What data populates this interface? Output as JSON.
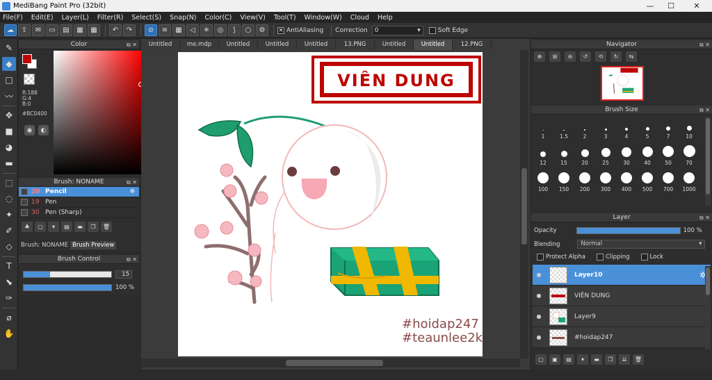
{
  "window": {
    "title": "MediBang Paint Pro (32bit)",
    "minimize": "—",
    "maximize": "☐",
    "close": "✕"
  },
  "menu": [
    "File(F)",
    "Edit(E)",
    "Layer(L)",
    "Filter(R)",
    "Select(S)",
    "Snap(N)",
    "Color(C)",
    "View(V)",
    "Tool(T)",
    "Window(W)",
    "Cloud",
    "Help"
  ],
  "toolbar": {
    "antialiasing_label": "AntiAliasing",
    "correction_label": "Correction",
    "correction_value": "0",
    "soft_edge_label": "Soft Edge"
  },
  "color_panel": {
    "title": "Color",
    "r": "R:188",
    "g": "G:4",
    "b": "B:0",
    "hex": "#BC0400",
    "fg_color": "#BC0400"
  },
  "brush_panel": {
    "title": "Brush: NONAME",
    "items": [
      {
        "size": "20",
        "name": "Pencil",
        "selected": true
      },
      {
        "size": "19",
        "name": "Pen",
        "selected": false
      },
      {
        "size": "30",
        "name": "Pen (Sharp)",
        "selected": false
      }
    ],
    "tab_brush": "Brush: NONAME",
    "tab_preview": "Brush Preview"
  },
  "brush_control": {
    "title": "Brush Control",
    "size_value": "15",
    "opacity_value": "100 %",
    "size_fraction": 0.3,
    "opacity_fraction": 1.0
  },
  "document_tabs": [
    "Untitled",
    "me.mdp",
    "Untitled",
    "Untitled",
    "Untitled",
    "13.PNG",
    "Untitled",
    "Untitled",
    "12.PNG"
  ],
  "active_tab_index": 7,
  "canvas": {
    "stamp_text": "VIÊN DUNG",
    "tag1": "#hoidap247",
    "tag2": "#teaunlee2k"
  },
  "navigator": {
    "title": "Navigator"
  },
  "brush_size": {
    "title": "Brush Size",
    "sizes": [
      "1",
      "1.5",
      "2",
      "3",
      "4",
      "5",
      "7",
      "10",
      "12",
      "15",
      "20",
      "25",
      "30",
      "40",
      "50",
      "70",
      "100",
      "150",
      "200",
      "300",
      "400",
      "500",
      "700",
      "1000"
    ]
  },
  "layer_panel": {
    "title": "Layer",
    "opacity_label": "Opacity",
    "opacity_value": "100 %",
    "blending_label": "Blending",
    "blending_value": "Normal",
    "protect_alpha": "Protect Alpha",
    "clipping": "Clipping",
    "lock": "Lock",
    "layers": [
      {
        "name": "Layer10",
        "selected": true
      },
      {
        "name": "VIÊN DUNG",
        "selected": false
      },
      {
        "name": "Layer9",
        "selected": false
      },
      {
        "name": "#hoidap247",
        "selected": false
      }
    ]
  }
}
